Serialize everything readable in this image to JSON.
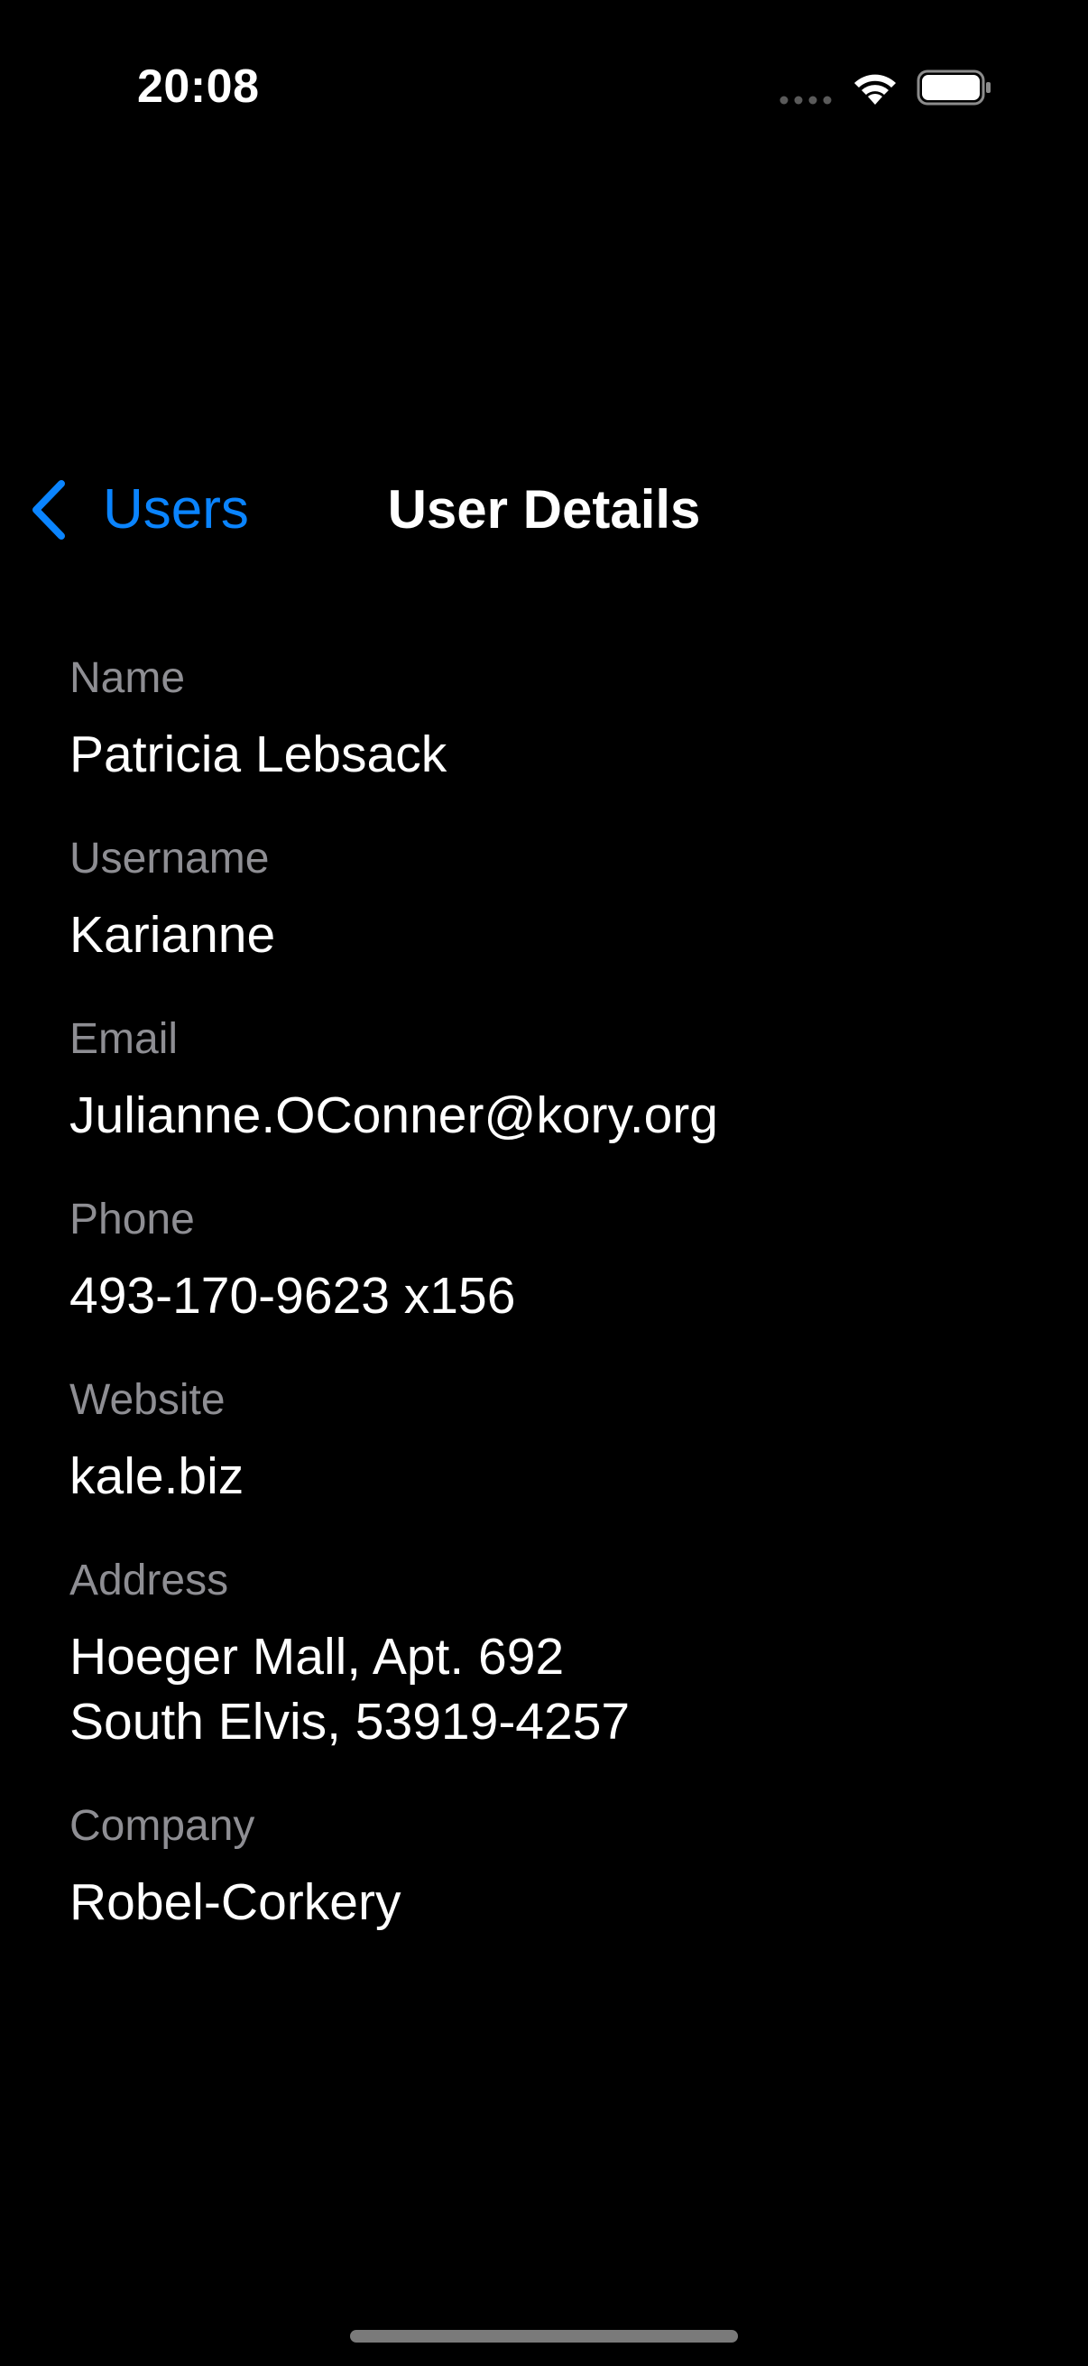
{
  "status_bar": {
    "time": "20:08"
  },
  "nav": {
    "back_label": "Users",
    "title": "User Details"
  },
  "fields": [
    {
      "label": "Name",
      "value": "Patricia Lebsack"
    },
    {
      "label": "Username",
      "value": "Karianne"
    },
    {
      "label": "Email",
      "value": "Julianne.OConner@kory.org"
    },
    {
      "label": "Phone",
      "value": "493-170-9623 x156"
    },
    {
      "label": "Website",
      "value": "kale.biz"
    },
    {
      "label": "Address",
      "value": "Hoeger Mall, Apt. 692\nSouth Elvis, 53919-4257"
    },
    {
      "label": "Company",
      "value": "Robel-Corkery"
    }
  ],
  "icons": {
    "back": "chevron-left-icon",
    "signal": "signal-dots-icon",
    "wifi": "wifi-icon",
    "battery": "battery-icon"
  },
  "colors": {
    "background": "#000000",
    "accent": "#0a84ff",
    "label": "#8e8e93",
    "text": "#ffffff"
  }
}
